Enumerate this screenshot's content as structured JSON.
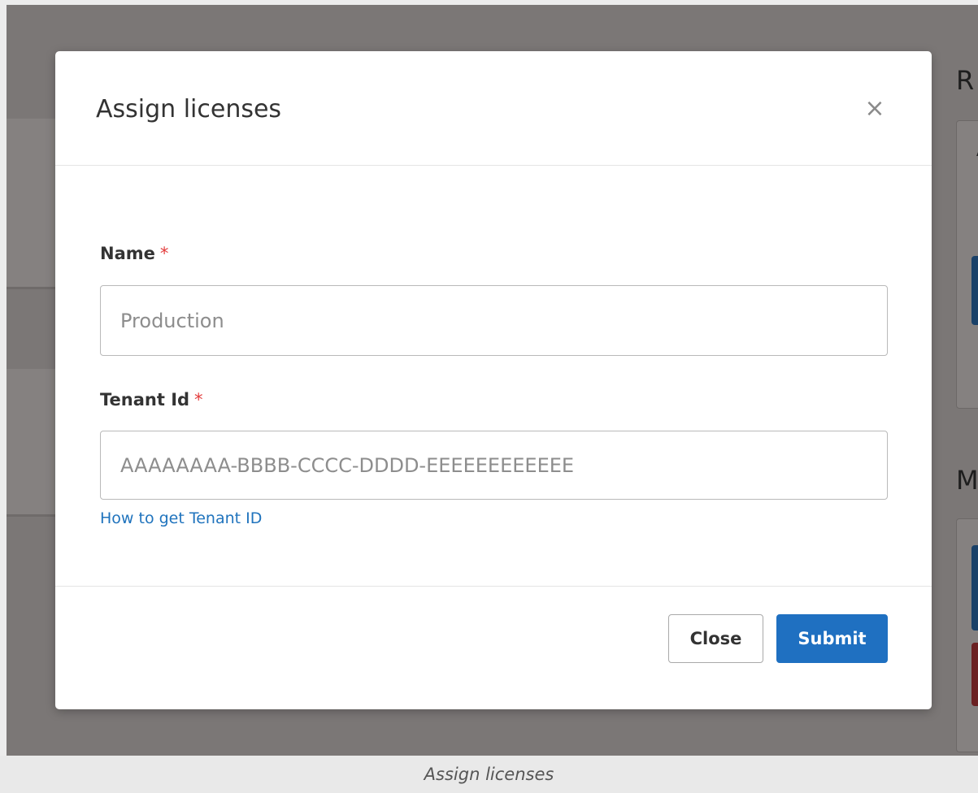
{
  "modal": {
    "title": "Assign licenses",
    "close_icon": "×",
    "fields": {
      "name": {
        "label": "Name",
        "required_mark": "*",
        "value": "",
        "placeholder": "Production"
      },
      "tenant_id": {
        "label": "Tenant Id",
        "required_mark": "*",
        "value": "",
        "placeholder": "AAAAAAAA-BBBB-CCCC-DDDD-EEEEEEEEEEEE"
      }
    },
    "help_link": "How to get Tenant ID",
    "buttons": {
      "close": "Close",
      "submit": "Submit"
    }
  },
  "background": {
    "heading_1": "R",
    "heading_2": "M",
    "glyph": "A"
  },
  "caption": "Assign licenses",
  "colors": {
    "primary": "#1f70c1",
    "link": "#1f73bd",
    "required": "#e33c3c",
    "backdrop": "#7b7776"
  }
}
